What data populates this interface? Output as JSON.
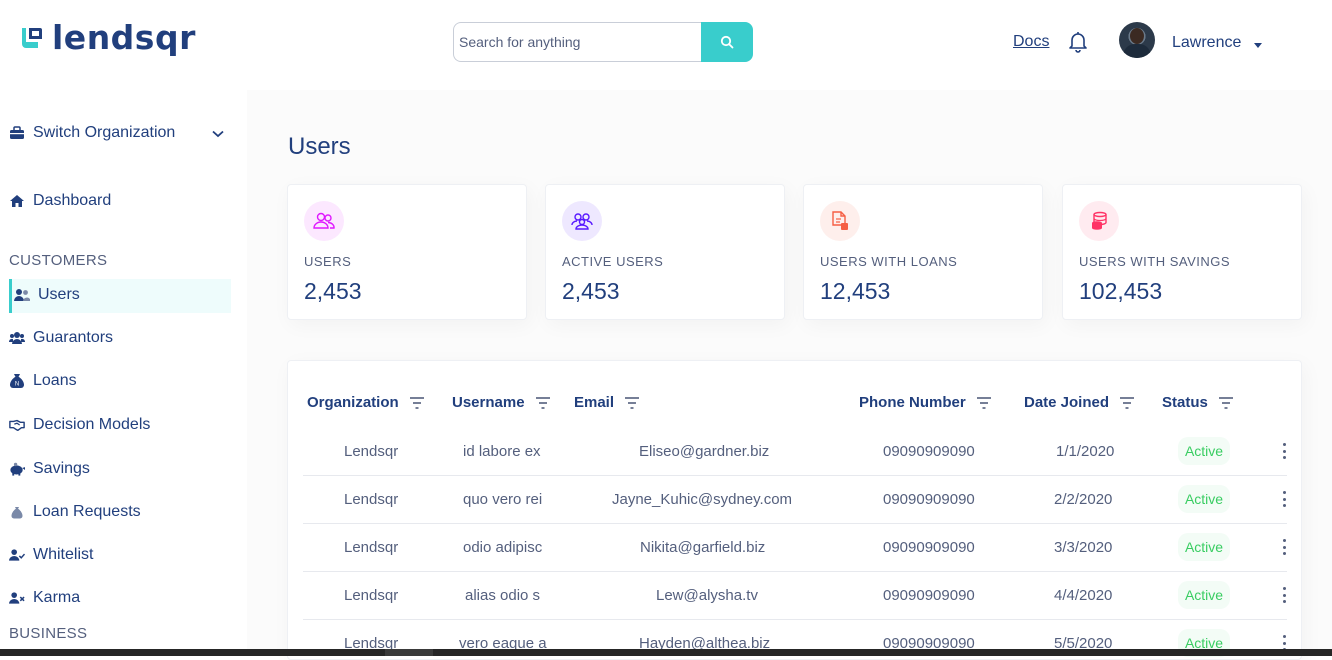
{
  "header": {
    "logo_text": "lendsqr",
    "search_placeholder": "Search for anything",
    "docs_label": "Docs",
    "user_name": "Lawrence"
  },
  "sidebar": {
    "switch_org": "Switch Organization",
    "dashboard": "Dashboard",
    "customers_heading": "CUSTOMERS",
    "items": [
      {
        "label": "Users",
        "icon": "users-icon"
      },
      {
        "label": "Guarantors",
        "icon": "guarantors-icon"
      },
      {
        "label": "Loans",
        "icon": "loans-sack-icon"
      },
      {
        "label": "Decision Models",
        "icon": "handshake-icon"
      },
      {
        "label": "Savings",
        "icon": "piggy-bank-icon"
      },
      {
        "label": "Loan Requests",
        "icon": "loan-request-icon"
      },
      {
        "label": "Whitelist",
        "icon": "user-check-icon"
      },
      {
        "label": "Karma",
        "icon": "user-x-icon"
      }
    ],
    "business_heading": "BUSINESS"
  },
  "main": {
    "title": "Users",
    "cards": [
      {
        "label": "USERS",
        "value": "2,453",
        "color": "#DF18FF"
      },
      {
        "label": "ACTIVE USERS",
        "value": "2,453",
        "color": "#5718FF"
      },
      {
        "label": "USERS WITH LOANS",
        "value": "12,453",
        "color": "#F55F44"
      },
      {
        "label": "USERS WITH SAVINGS",
        "value": "102,453",
        "color": "#FF3366"
      }
    ],
    "table": {
      "columns": [
        "Organization",
        "Username",
        "Email",
        "Phone Number",
        "Date Joined",
        "Status"
      ],
      "rows": [
        {
          "org": "Lendsqr",
          "username": "id labore ex",
          "email": "Eliseo@gardner.biz",
          "phone": "09090909090",
          "date": "1/1/2020",
          "status": "Active"
        },
        {
          "org": "Lendsqr",
          "username": "quo vero rei",
          "email": "Jayne_Kuhic@sydney.com",
          "phone": "09090909090",
          "date": "2/2/2020",
          "status": "Active"
        },
        {
          "org": "Lendsqr",
          "username": "odio adipisc",
          "email": "Nikita@garfield.biz",
          "phone": "09090909090",
          "date": "3/3/2020",
          "status": "Active"
        },
        {
          "org": "Lendsqr",
          "username": "alias odio s",
          "email": "Lew@alysha.tv",
          "phone": "09090909090",
          "date": "4/4/2020",
          "status": "Active"
        },
        {
          "org": "Lendsqr",
          "username": "vero eaque a",
          "email": "Hayden@althea.biz",
          "phone": "09090909090",
          "date": "5/5/2020",
          "status": "Active"
        }
      ]
    }
  },
  "colors": {
    "primary": "#213F7D",
    "accent": "#39CDCC",
    "text_secondary": "#545F7D",
    "active_green": "#39CD62"
  }
}
